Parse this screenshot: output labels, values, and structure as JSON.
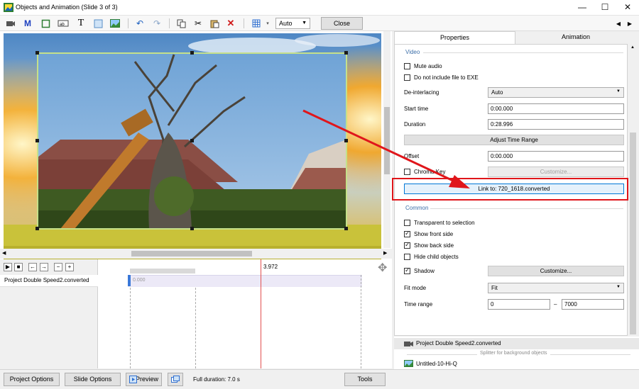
{
  "window": {
    "title": "Objects and Animation (Slide 3 of 3)",
    "minimize_glyph": "—",
    "maximize_glyph": "☐",
    "close_glyph": "✕"
  },
  "toolbar": {
    "zoom_value": "Auto",
    "close_label": "Close",
    "icons": [
      "camera-icon",
      "m-icon",
      "rectangle-icon",
      "label-icon",
      "text-icon",
      "frame-icon",
      "image-icon",
      "undo-icon",
      "redo-icon",
      "copy-icon",
      "cut-icon",
      "paste-icon",
      "delete-icon",
      "grid-icon",
      "prev-icon",
      "next-icon"
    ]
  },
  "timeline": {
    "marker_time": "3.972",
    "track_label": "Project Double Speed2.converted",
    "bar_start": "0.000"
  },
  "tabs": {
    "properties": "Properties",
    "animation": "Animation"
  },
  "video": {
    "section": "Video",
    "mute_audio": "Mute audio",
    "do_not_include": "Do not include file to EXE",
    "deinterlacing_label": "De-interlacing",
    "deinterlacing_value": "Auto",
    "start_time_label": "Start time",
    "start_time_value": "0:00.000",
    "duration_label": "Duration",
    "duration_value": "0:28.996",
    "adjust_time_range": "Adjust Time Range",
    "offset_label": "Offset",
    "offset_value": "0:00.000",
    "chroma_key": "Chroma Key",
    "customize_disabled": "Customize...",
    "link_to": "Link to: 720_1618.converted"
  },
  "common": {
    "section": "Common",
    "transparent": "Transparent to selection",
    "show_front": "Show front side",
    "show_back": "Show back side",
    "hide_child": "Hide child objects",
    "shadow": "Shadow",
    "customize": "Customize...",
    "fit_mode_label": "Fit mode",
    "fit_mode_value": "Fit",
    "time_range_label": "Time range",
    "time_range_from": "0",
    "time_range_sep": "–",
    "time_range_to": "7000"
  },
  "objects": {
    "item1": "Project Double Speed2.converted",
    "splitter": "Splitter for background objects",
    "item2": "Untitled-10-Hi-Q"
  },
  "bottom": {
    "project_options": "Project Options",
    "slide_options": "Slide Options",
    "preview": "Preview",
    "full_duration": "Full duration: 7.0 s",
    "tools": "Tools"
  },
  "colors": {
    "highlight": "#e0161b",
    "section_text": "#3c6ea8",
    "playhead": "#e25050"
  }
}
